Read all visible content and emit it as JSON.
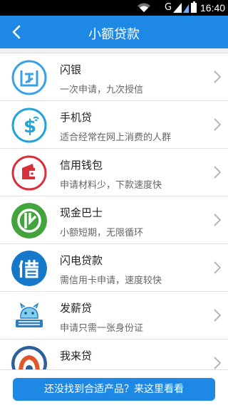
{
  "status_bar": {
    "network": "G",
    "time": "16:40"
  },
  "header": {
    "title": "小额贷款"
  },
  "products": [
    {
      "name": "闪银",
      "desc": "一次申请，九次授信",
      "logo": "shanyin-logo"
    },
    {
      "name": "手机贷",
      "desc": "适合经常在网上消费的人群",
      "logo": "shoujidai-logo"
    },
    {
      "name": "信用钱包",
      "desc": "申请材料少，下款速度快",
      "logo": "wallet-logo"
    },
    {
      "name": "现金巴士",
      "desc": "小额短期，无限循环",
      "logo": "cashbus-logo"
    },
    {
      "name": "闪电贷款",
      "desc": "需信用卡申请，速度较快",
      "logo": "jie-logo"
    },
    {
      "name": "发薪贷",
      "desc": "申请只需一张身份证",
      "logo": "faxindai-logo"
    },
    {
      "name": "我来贷",
      "desc": "",
      "logo": "wolaidai-logo"
    }
  ],
  "footer": {
    "cta_label": "还没找到合适产品？来这里看看"
  },
  "colors": {
    "accent": "#1e88e5"
  }
}
